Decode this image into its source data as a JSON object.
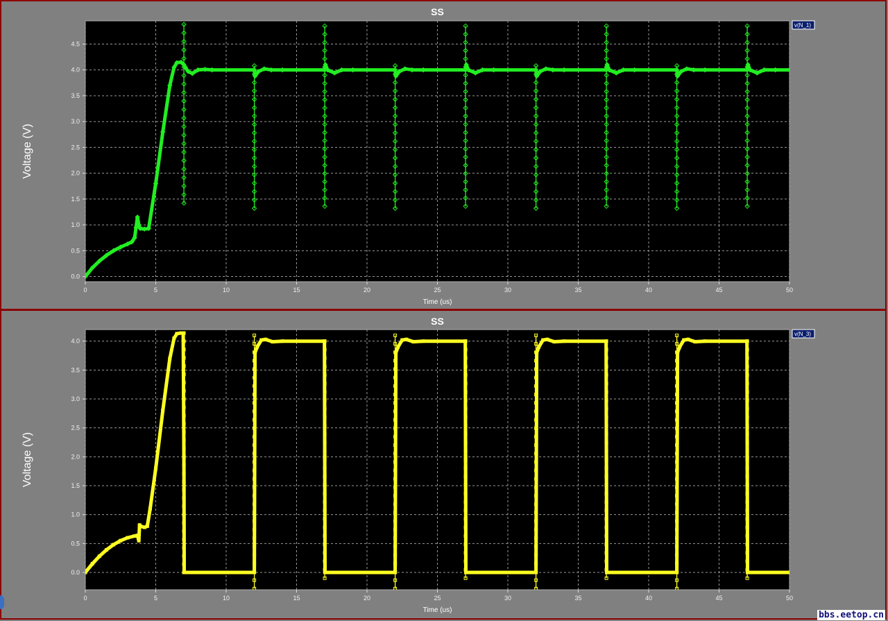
{
  "colors": {
    "background": "#808080",
    "plot_bg": "#000000",
    "border": "#8b0000",
    "grid": "#9a9a9a",
    "legend_bg": "#0b1f6e",
    "legend_text": "#ffffff"
  },
  "watermark": "bbs.eetop.cn",
  "chart_data": [
    {
      "type": "line",
      "title": "SS",
      "xlabel": "Time (us)",
      "ylabel": "Voltage (V)",
      "xlim": [
        0,
        50
      ],
      "ylim": [
        -0.1,
        4.95
      ],
      "xticks": [
        0,
        5,
        10,
        15,
        20,
        25,
        30,
        35,
        40,
        45,
        50
      ],
      "yticks": [
        0.0,
        0.5,
        1.0,
        1.5,
        2.0,
        2.5,
        3.0,
        3.5,
        4.0,
        4.5
      ],
      "ytick_labels": [
        "0.0",
        "0.5",
        "1.0",
        "1.5",
        "2.0",
        "2.5",
        "3.0",
        "3.5",
        "4.0",
        "4.5"
      ],
      "grid": true,
      "legend": "top-right",
      "marker": "diamond",
      "series": [
        {
          "name": "v(N_1)",
          "color": "#22ee22",
          "x": [
            0,
            0.5,
            1,
            1.5,
            2,
            2.5,
            3,
            3.3,
            3.5,
            3.6,
            3.7,
            3.8,
            3.9,
            4.2,
            4.5,
            5,
            5.5,
            6,
            6.3,
            6.5,
            6.8,
            7,
            7.1,
            7.3,
            7.6,
            8,
            8.5,
            9,
            12,
            12.05,
            12.3,
            12.7,
            13.2,
            14,
            17,
            17.05,
            17.2,
            17.7,
            18.2,
            19,
            22,
            22.05,
            22.3,
            22.7,
            23.2,
            24,
            27,
            27.05,
            27.2,
            27.7,
            28.2,
            29,
            32,
            32.05,
            32.3,
            32.7,
            33.2,
            34,
            37,
            37.05,
            37.2,
            37.7,
            38.2,
            39,
            42,
            42.05,
            42.3,
            42.7,
            43.2,
            44,
            47,
            47.05,
            47.2,
            47.7,
            48.2,
            49,
            50
          ],
          "y": [
            0,
            0.17,
            0.3,
            0.41,
            0.5,
            0.57,
            0.63,
            0.67,
            0.75,
            0.95,
            1.15,
            1.0,
            0.93,
            0.92,
            0.93,
            1.8,
            2.8,
            3.7,
            4.05,
            4.14,
            4.15,
            4.1,
            4.05,
            3.97,
            3.93,
            4.0,
            4.01,
            4.0,
            4.0,
            3.88,
            3.97,
            4.02,
            4.0,
            4.0,
            4.0,
            4.1,
            4.0,
            3.94,
            4.0,
            4.0,
            4.0,
            3.88,
            3.97,
            4.02,
            4.0,
            4.0,
            4.0,
            4.1,
            4.0,
            3.94,
            4.0,
            4.0,
            4.0,
            3.88,
            3.97,
            4.02,
            4.0,
            4.0,
            4.0,
            4.1,
            4.0,
            3.94,
            4.0,
            4.0,
            4.0,
            3.88,
            3.97,
            4.02,
            4.0,
            4.0,
            4.0,
            4.1,
            4.0,
            3.94,
            4.0,
            4.0,
            4.0
          ]
        }
      ],
      "spikes": [
        {
          "x": 7.0,
          "ymin": 1.42,
          "ymax": 4.88
        },
        {
          "x": 12.0,
          "ymin": 1.32,
          "ymax": 4.08
        },
        {
          "x": 17.0,
          "ymin": 1.36,
          "ymax": 4.85
        },
        {
          "x": 22.0,
          "ymin": 1.32,
          "ymax": 4.08
        },
        {
          "x": 27.0,
          "ymin": 1.36,
          "ymax": 4.85
        },
        {
          "x": 32.0,
          "ymin": 1.32,
          "ymax": 4.08
        },
        {
          "x": 37.0,
          "ymin": 1.36,
          "ymax": 4.85
        },
        {
          "x": 42.0,
          "ymin": 1.32,
          "ymax": 4.08
        },
        {
          "x": 47.0,
          "ymin": 1.36,
          "ymax": 4.85
        }
      ]
    },
    {
      "type": "line",
      "title": "SS",
      "xlabel": "Time (us)",
      "ylabel": "Voltage (V)",
      "xlim": [
        0,
        50
      ],
      "ylim": [
        -0.3,
        4.2
      ],
      "xticks": [
        0,
        5,
        10,
        15,
        20,
        25,
        30,
        35,
        40,
        45,
        50
      ],
      "yticks": [
        0.0,
        0.5,
        1.0,
        1.5,
        2.0,
        2.5,
        3.0,
        3.5,
        4.0
      ],
      "ytick_labels": [
        "0.0",
        "0.5",
        "1.0",
        "1.5",
        "2.0",
        "2.5",
        "3.0",
        "3.5",
        "4.0"
      ],
      "grid": true,
      "legend": "top-right",
      "marker": "square",
      "series": [
        {
          "name": "v(N_3)",
          "color": "#ffff22",
          "x": [
            0,
            0.5,
            1,
            1.5,
            2,
            2.5,
            3,
            3.5,
            3.7,
            3.8,
            3.85,
            3.9,
            4.2,
            4.4,
            4.6,
            5,
            5.5,
            6,
            6.3,
            6.5,
            6.8,
            6.95,
            7.0,
            7.02,
            11.98,
            12.0,
            12.05,
            12.2,
            12.5,
            12.8,
            13.3,
            14,
            16.98,
            17.0,
            17.02,
            21.98,
            22.0,
            22.05,
            22.2,
            22.5,
            22.8,
            23.3,
            24,
            26.98,
            27.0,
            27.02,
            31.98,
            32.0,
            32.05,
            32.2,
            32.5,
            32.8,
            33.3,
            34,
            36.98,
            37.0,
            37.02,
            41.98,
            42.0,
            42.05,
            42.2,
            42.5,
            42.8,
            43.3,
            44,
            46.98,
            47.0,
            47.02,
            50
          ],
          "y": [
            0,
            0.15,
            0.28,
            0.39,
            0.48,
            0.55,
            0.6,
            0.63,
            0.64,
            0.55,
            0.82,
            0.8,
            0.78,
            0.8,
            1.1,
            1.8,
            2.8,
            3.7,
            4.05,
            4.13,
            4.14,
            4.14,
            2.0,
            0,
            0,
            0,
            3.8,
            3.9,
            4.02,
            4.03,
            3.99,
            4.0,
            4.0,
            2.0,
            0,
            0,
            0,
            3.8,
            3.9,
            4.02,
            4.03,
            3.99,
            4.0,
            4.0,
            2.0,
            0,
            0,
            0,
            3.8,
            3.9,
            4.02,
            4.03,
            3.99,
            4.0,
            4.0,
            2.0,
            0,
            0,
            0,
            3.8,
            3.9,
            4.02,
            4.03,
            3.99,
            4.0,
            4.0,
            2.0,
            0,
            0
          ]
        }
      ],
      "spikes": [
        {
          "x": 7.0,
          "ymin": 0.0,
          "ymax": 4.14
        },
        {
          "x": 12.0,
          "ymin": -0.28,
          "ymax": 4.1
        },
        {
          "x": 17.0,
          "ymin": -0.1,
          "ymax": 4.0
        },
        {
          "x": 22.0,
          "ymin": -0.28,
          "ymax": 4.1
        },
        {
          "x": 27.0,
          "ymin": -0.1,
          "ymax": 4.0
        },
        {
          "x": 32.0,
          "ymin": -0.28,
          "ymax": 4.1
        },
        {
          "x": 37.0,
          "ymin": -0.1,
          "ymax": 4.0
        },
        {
          "x": 42.0,
          "ymin": -0.28,
          "ymax": 4.1
        },
        {
          "x": 47.0,
          "ymin": -0.1,
          "ymax": 4.0
        }
      ]
    }
  ]
}
